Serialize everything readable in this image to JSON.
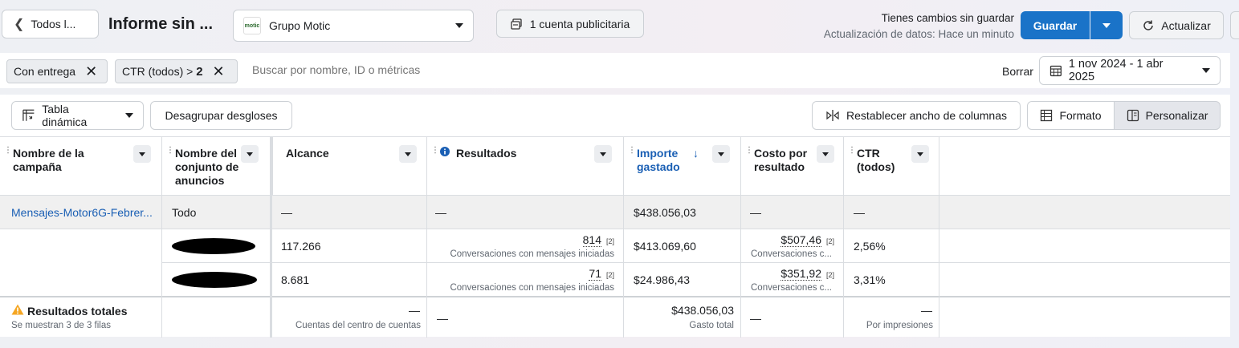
{
  "header": {
    "back_label": "Todos l...",
    "report_title": "Informe sin ...",
    "account_name": "Grupo Motic",
    "account_logo_text": "motic",
    "ad_accounts_label": "1 cuenta publicitaria",
    "unsaved_changes": "Tienes cambios sin guardar",
    "data_update": "Actualización de datos: Hace un minuto",
    "save_label": "Guardar",
    "refresh_label": "Actualizar"
  },
  "filters": {
    "chips": [
      {
        "label": "Con entrega"
      },
      {
        "label": "CTR (todos) > ",
        "value": "2"
      }
    ],
    "search_placeholder": "Buscar por nombre, ID o métricas",
    "clear_label": "Borrar",
    "date_range": "1 nov 2024 - 1 abr 2025"
  },
  "toolbar": {
    "pivot_label": "Tabla dinámica",
    "ungroup_label": "Desagrupar desgloses",
    "reset_width_label": "Restablecer ancho de columnas",
    "format_label": "Formato",
    "customize_label": "Personalizar"
  },
  "table": {
    "columns": [
      {
        "label": "Nombre de la campaña"
      },
      {
        "label": "Nombre del conjunto de anuncios"
      },
      {
        "label": "Alcance"
      },
      {
        "label": "Resultados"
      },
      {
        "label": "Importe gastado",
        "sorted": "desc"
      },
      {
        "label": "Costo por resultado"
      },
      {
        "label": "CTR (todos)"
      }
    ],
    "rows": [
      {
        "campaign": "Mensajes-Motor6G-Febrer...",
        "adset": "Todo",
        "reach": "—",
        "results": "—",
        "spent": "$438.056,03",
        "cost_per_result": "—",
        "ctr": "—"
      },
      {
        "campaign": "",
        "adset": "",
        "reach": "117.266",
        "results": "814",
        "results_ref": "[2]",
        "results_sub": "Conversaciones con mensajes iniciadas",
        "spent": "$413.069,60",
        "cost_per_result": "$507,46",
        "cost_ref": "[2]",
        "cost_sub": "Conversaciones c...",
        "ctr": "2,56%"
      },
      {
        "campaign": "",
        "adset": "",
        "reach": "8.681",
        "results": "71",
        "results_ref": "[2]",
        "results_sub": "Conversaciones con mensajes iniciadas",
        "spent": "$24.986,43",
        "cost_per_result": "$351,92",
        "cost_ref": "[2]",
        "cost_sub": "Conversaciones c...",
        "ctr": "3,31%"
      }
    ],
    "totals": {
      "label": "Resultados totales",
      "rows_shown": "Se muestran 3 de 3 filas",
      "reach": "—",
      "reach_sub": "Cuentas del centro de cuentas",
      "results": "—",
      "spent": "$438.056,03",
      "spent_sub": "Gasto total",
      "cost_per_result": "—",
      "ctr": "—",
      "ctr_sub": "Por impresiones"
    }
  },
  "colors": {
    "primary": "#1a73c8",
    "link": "#1a5fb4",
    "warning": "#f5a623"
  }
}
